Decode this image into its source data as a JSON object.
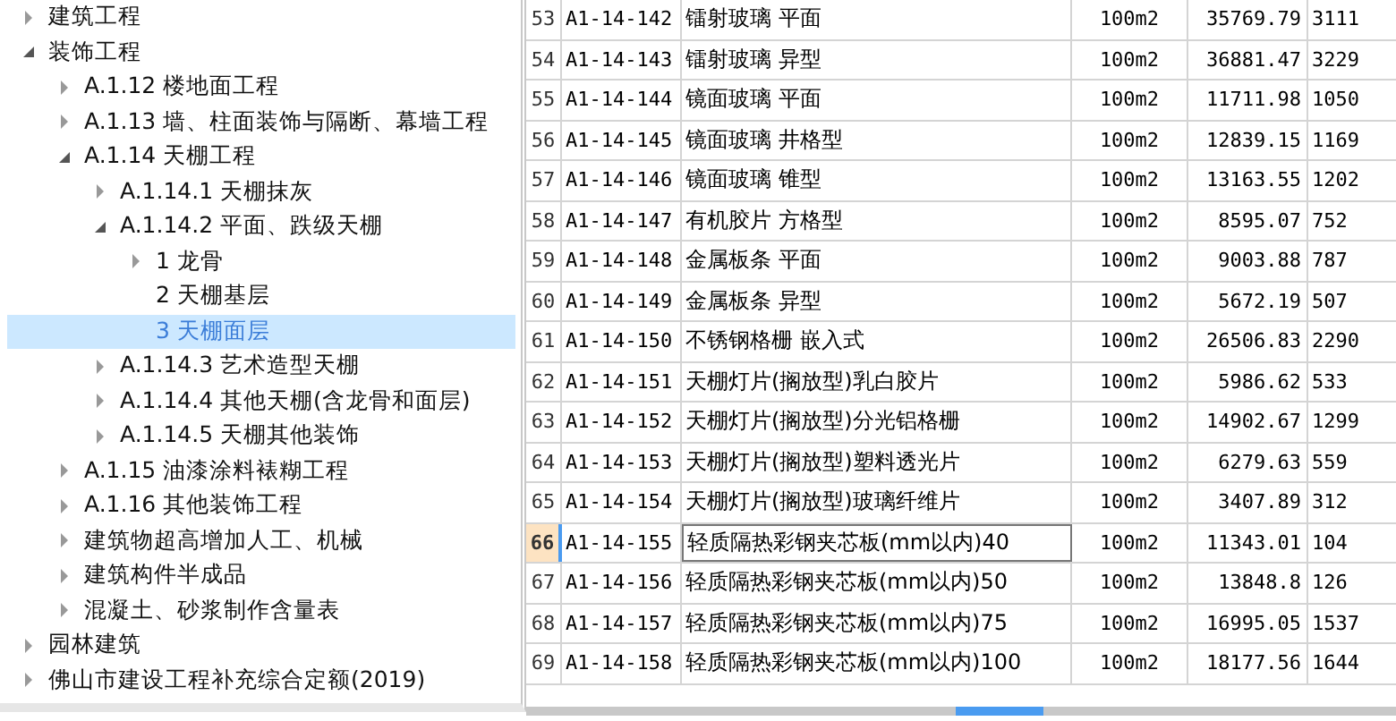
{
  "tree": [
    {
      "label": "建筑工程",
      "expanded": false,
      "selected": false
    },
    {
      "label": "装饰工程",
      "expanded": true,
      "selected": false,
      "children": [
        {
          "label": "A.1.12 楼地面工程",
          "expanded": false,
          "selected": false
        },
        {
          "label": "A.1.13 墙、柱面装饰与隔断、幕墙工程",
          "expanded": false,
          "selected": false
        },
        {
          "label": "A.1.14 天棚工程",
          "expanded": true,
          "selected": false,
          "children": [
            {
              "label": "A.1.14.1 天棚抹灰",
              "expanded": false,
              "selected": false
            },
            {
              "label": "A.1.14.2 平面、跌级天棚",
              "expanded": true,
              "selected": false,
              "children": [
                {
                  "label": "1 龙骨",
                  "expanded": false,
                  "selected": false
                },
                {
                  "label": "2 天棚基层",
                  "selected": false
                },
                {
                  "label": "3 天棚面层",
                  "selected": true
                }
              ]
            },
            {
              "label": "A.1.14.3 艺术造型天棚",
              "expanded": false,
              "selected": false
            },
            {
              "label": "A.1.14.4 其他天棚(含龙骨和面层)",
              "expanded": false,
              "selected": false
            },
            {
              "label": "A.1.14.5 天棚其他装饰",
              "expanded": false,
              "selected": false
            }
          ]
        },
        {
          "label": "A.1.15 油漆涂料裱糊工程",
          "expanded": false,
          "selected": false
        },
        {
          "label": "A.1.16 其他装饰工程",
          "expanded": false,
          "selected": false
        },
        {
          "label": "建筑物超高增加人工、机械",
          "expanded": false,
          "selected": false
        },
        {
          "label": "建筑构件半成品",
          "expanded": false,
          "selected": false
        },
        {
          "label": "混凝土、砂浆制作含量表",
          "expanded": false,
          "selected": false
        }
      ]
    },
    {
      "label": "园林建筑",
      "expanded": false,
      "selected": false
    },
    {
      "label": "佛山市建设工程补充综合定额(2019)",
      "expanded": false,
      "selected": false
    }
  ],
  "table": {
    "rows": [
      {
        "number": "53",
        "column_2": "A1-14-142",
        "column_3": "镭射玻璃 平面",
        "column_4": "100m2",
        "column_5": "35769.79",
        "column_6": "3111",
        "selected": false
      },
      {
        "number": "54",
        "column_2": "A1-14-143",
        "column_3": "镭射玻璃 异型",
        "column_4": "100m2",
        "column_5": "36881.47",
        "column_6": "3229",
        "selected": false
      },
      {
        "number": "55",
        "column_2": "A1-14-144",
        "column_3": "镜面玻璃 平面",
        "column_4": "100m2",
        "column_5": "11711.98",
        "column_6": "1050",
        "selected": false
      },
      {
        "number": "56",
        "column_2": "A1-14-145",
        "column_3": "镜面玻璃 井格型",
        "column_4": "100m2",
        "column_5": "12839.15",
        "column_6": "1169",
        "selected": false
      },
      {
        "number": "57",
        "column_2": "A1-14-146",
        "column_3": "镜面玻璃 锥型",
        "column_4": "100m2",
        "column_5": "13163.55",
        "column_6": "1202",
        "selected": false
      },
      {
        "number": "58",
        "column_2": "A1-14-147",
        "column_3": "有机胶片 方格型",
        "column_4": "100m2",
        "column_5": "8595.07",
        "column_6": "752",
        "selected": false
      },
      {
        "number": "59",
        "column_2": "A1-14-148",
        "column_3": "金属板条 平面",
        "column_4": "100m2",
        "column_5": "9003.88",
        "column_6": "787",
        "selected": false
      },
      {
        "number": "60",
        "column_2": "A1-14-149",
        "column_3": "金属板条 异型",
        "column_4": "100m2",
        "column_5": "5672.19",
        "column_6": "507",
        "selected": false
      },
      {
        "number": "61",
        "column_2": "A1-14-150",
        "column_3": "不锈钢格栅 嵌入式",
        "column_4": "100m2",
        "column_5": "26506.83",
        "column_6": "2290",
        "selected": false
      },
      {
        "number": "62",
        "column_2": "A1-14-151",
        "column_3": "天棚灯片(搁放型)乳白胶片",
        "column_4": "100m2",
        "column_5": "5986.62",
        "column_6": "533",
        "selected": false
      },
      {
        "number": "63",
        "column_2": "A1-14-152",
        "column_3": "天棚灯片(搁放型)分光铝格栅",
        "column_4": "100m2",
        "column_5": "14902.67",
        "column_6": "1299",
        "selected": false
      },
      {
        "number": "64",
        "column_2": "A1-14-153",
        "column_3": "天棚灯片(搁放型)塑料透光片",
        "column_4": "100m2",
        "column_5": "6279.63",
        "column_6": "559",
        "selected": false
      },
      {
        "number": "65",
        "column_2": "A1-14-154",
        "column_3": "天棚灯片(搁放型)玻璃纤维片",
        "column_4": "100m2",
        "column_5": "3407.89",
        "column_6": "312",
        "selected": false
      },
      {
        "number": "66",
        "column_2": "A1-14-155",
        "column_3": "轻质隔热彩钢夹芯板(mm以内)40",
        "column_4": "100m2",
        "column_5": "11343.01",
        "column_6": "104",
        "selected": true
      },
      {
        "number": "67",
        "column_2": "A1-14-156",
        "column_3": "轻质隔热彩钢夹芯板(mm以内)50",
        "column_4": "100m2",
        "column_5": "13848.8",
        "column_6": "126",
        "selected": false
      },
      {
        "number": "68",
        "column_2": "A1-14-157",
        "column_3": "轻质隔热彩钢夹芯板(mm以内)75",
        "column_4": "100m2",
        "column_5": "16995.05",
        "column_6": "1537",
        "selected": false
      },
      {
        "number": "69",
        "column_2": "A1-14-158",
        "column_3": "轻质隔热彩钢夹芯板(mm以内)100",
        "column_4": "100m2",
        "column_5": "18177.56",
        "column_6": "1644",
        "selected": false
      }
    ]
  }
}
